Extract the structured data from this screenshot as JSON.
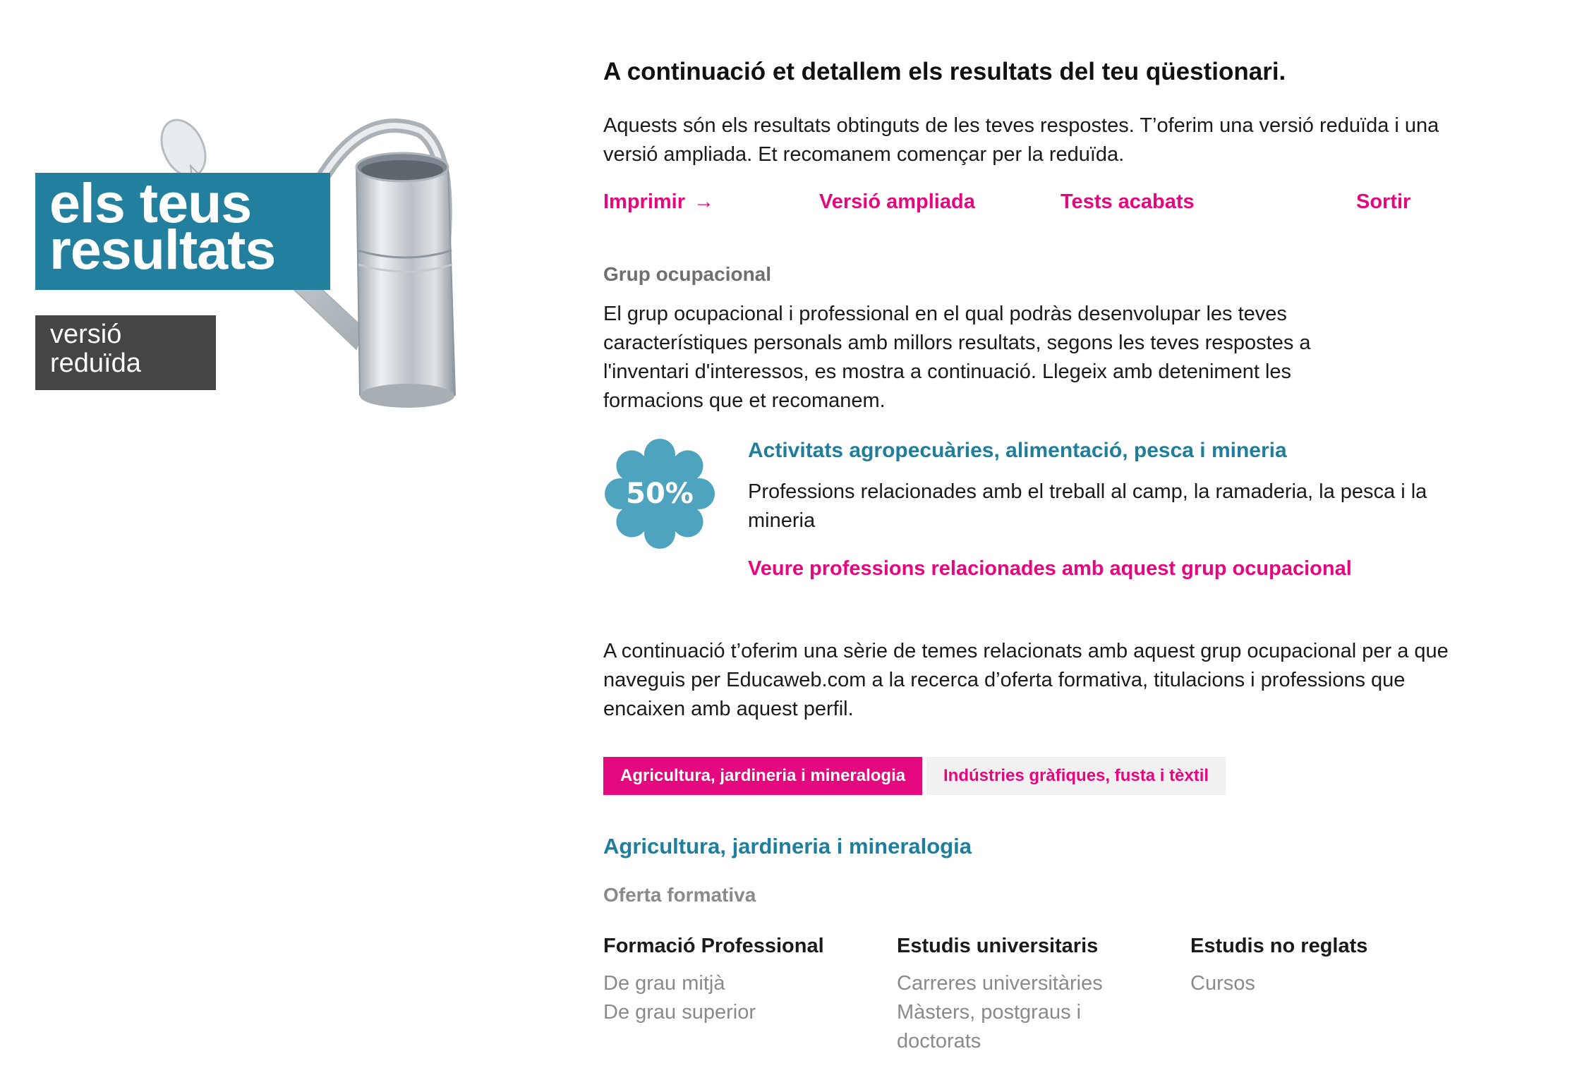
{
  "hero": {
    "title_line1": "els teus",
    "title_line2": "resultats",
    "subtitle_line1": "versió",
    "subtitle_line2": "reduïda",
    "image": "watering-can-icon",
    "title_bg": "#22809e",
    "subtitle_bg": "#454545"
  },
  "intro": {
    "title": "A continuació et detallem els resultats del teu qüestionari.",
    "text": "Aquests són els resultats obtinguts de les teves respostes. T’oferim una versió reduïda i una versió ampliada. Et recomanem començar per la reduïda."
  },
  "nav": {
    "print": "Imprimir",
    "print_arrow": "→",
    "extended": "Versió ampliada",
    "finished_tests": "Tests acabats",
    "exit": "Sortir"
  },
  "group": {
    "label": "Grup ocupacional",
    "text": "El grup ocupacional i professional en el qual podràs desenvolupar les teves característiques personals amb millors resultats, segons les teves respostes a l'inventari d'interessos, es mostra a continuació. Llegeix amb deteniment les formacions que et recomanem.",
    "percentage": "50%",
    "name": "Activitats agropecuàries, alimentació, pesca i mineria",
    "description": "Professions relacionades amb el treball al camp, la ramaderia, la pesca i la mineria",
    "link": "Veure professions relacionades amb aquest grup ocupacional"
  },
  "topics": {
    "text": "A continuació t’oferim una sèrie de temes relacionats amb aquest grup ocupacional per a que naveguis per Educaweb.com a la recerca d’oferta formativa, titulacions i professions que encaixen amb aquest perfil.",
    "tabs": [
      {
        "label": "Agricultura, jardineria i mineralogia",
        "active": true
      },
      {
        "label": "Indústries gràfiques, fusta i tèxtil",
        "active": false
      }
    ]
  },
  "section": {
    "title": "Agricultura, jardineria i mineralogia",
    "offer_label": "Oferta formativa",
    "columns": [
      {
        "heading": "Formació Professional",
        "items": [
          "De grau mitjà",
          "De grau superior"
        ]
      },
      {
        "heading": "Estudis universitaris",
        "items": [
          "Carreres universitàries",
          "Màsters, postgraus i doctorats"
        ]
      },
      {
        "heading": "Estudis no reglats",
        "items": [
          "Cursos"
        ]
      }
    ]
  },
  "colors": {
    "accent_pink": "#e4087e",
    "accent_teal": "#1f7e9b",
    "badge_blue": "#4ea3be"
  }
}
